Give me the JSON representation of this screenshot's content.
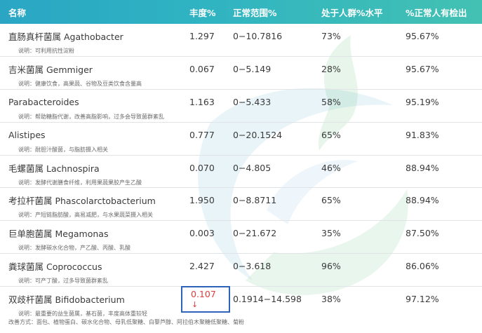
{
  "header": {
    "name": "名称",
    "abundance": "丰度%",
    "normal_range": "正常范围%",
    "population_level": "处于人群%水平",
    "normal_detected": "%正常人有检出"
  },
  "rows": [
    {
      "name": "直肠真杆菌属 Agathobacter",
      "abundance": "1.297",
      "range": "0−10.7816",
      "percentile": "73%",
      "detected": "95.67%",
      "note": "说明：可利用抗性淀粉"
    },
    {
      "name": "吉米菌属 Gemmiger",
      "abundance": "0.067",
      "range": "0−5.149",
      "percentile": "28%",
      "detected": "95.67%",
      "note": "说明：健康饮食，高果蔬、谷物及豆类饮食含量高"
    },
    {
      "name": "Parabacteroides",
      "abundance": "1.163",
      "range": "0−5.433",
      "percentile": "58%",
      "detected": "95.19%",
      "note": "说明：帮助糖脂代谢，改善高脂影响，过多会导致菌群紊乱"
    },
    {
      "name": "Alistipes",
      "abundance": "0.777",
      "range": "0−20.1524",
      "percentile": "65%",
      "detected": "91.83%",
      "note": "说明：耐胆汁酸菌，与脂肪摄入相关"
    },
    {
      "name": "毛螺菌属 Lachnospira",
      "abundance": "0.070",
      "range": "0−4.805",
      "percentile": "46%",
      "detected": "88.94%",
      "note": "说明：发酵代谢膳食纤维，利用果蔬果胶产生乙酸"
    },
    {
      "name": "考拉杆菌属 Phascolarctobacterium",
      "abundance": "1.950",
      "range": "0−8.8711",
      "percentile": "65%",
      "detected": "88.94%",
      "note": "说明：产短链脂肪酸，高易减肥，与水果蔬菜摄入相关"
    },
    {
      "name": "巨单胞菌属 Megamonas",
      "abundance": "0.003",
      "range": "0−21.672",
      "percentile": "35%",
      "detected": "87.50%",
      "note": "说明：发酵碳水化合物，产乙酸、丙酸、乳酸"
    },
    {
      "name": "粪球菌属 Coprococcus",
      "abundance": "2.427",
      "range": "0−3.618",
      "percentile": "96%",
      "detected": "86.06%",
      "note": "说明：可产丁酸，过多导致菌群紊乱"
    },
    {
      "name": "双歧杆菌属 Bifidobacterium",
      "abundance": "0.107",
      "range": "0.1914−14.598",
      "percentile": "38%",
      "detected": "97.12%",
      "note": "说明：最重要的益生菌属，基石菌，丰度高体重较轻",
      "note2": "改善方式：面包、植物蛋白、碳水化合物、母乳低聚糖、白藜芦醇、阿拉伯木聚糖低聚糖、菊粉"
    }
  ],
  "colors": {
    "header_start": "#2aa6c4",
    "header_end": "#43c1b2",
    "alert_text": "#e43b3b",
    "alert_border": "#2d64b9"
  },
  "icons": {
    "low_indicator": "down-arrow-icon"
  }
}
